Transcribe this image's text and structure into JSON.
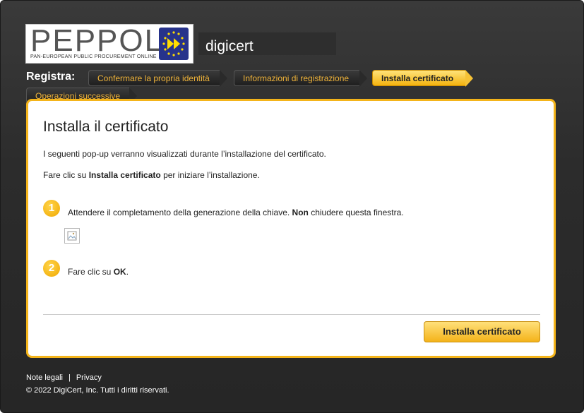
{
  "header": {
    "logo_text": "PEPPOL",
    "logo_subtitle": "PAN-EUROPEAN PUBLIC PROCUREMENT ONLINE",
    "brand": "digicert"
  },
  "steps": {
    "label": "Registra:",
    "items": [
      {
        "label": "Confermare la propria identità"
      },
      {
        "label": "Informazioni di registrazione"
      },
      {
        "label": "Installa certificato"
      },
      {
        "label": "Operazioni successive"
      }
    ]
  },
  "panel": {
    "title": "Installa il certificato",
    "intro": "I seguenti pop-up verranno visualizzati durante l’installazione del certificato.",
    "instruction_prefix": "Fare clic su ",
    "instruction_bold": "Installa certificato",
    "instruction_suffix": " per iniziare l’installazione.",
    "step1_number": "1",
    "step1_prefix": "Attendere il completamento della generazione della chiave. ",
    "step1_bold": "Non",
    "step1_suffix": " chiudere questa finestra.",
    "step2_number": "2",
    "step2_prefix": "Fare clic su ",
    "step2_bold": "OK",
    "step2_suffix": ".",
    "install_button": "Installa certificato"
  },
  "footer": {
    "legal": "Note legali",
    "separator": "|",
    "privacy": "Privacy",
    "copyright": "© 2022 DigiCert, Inc. Tutti i diritti riservati."
  },
  "colors": {
    "accent": "#f4b41a",
    "background": "#2c2c2c",
    "eu_blue": "#27338b"
  }
}
